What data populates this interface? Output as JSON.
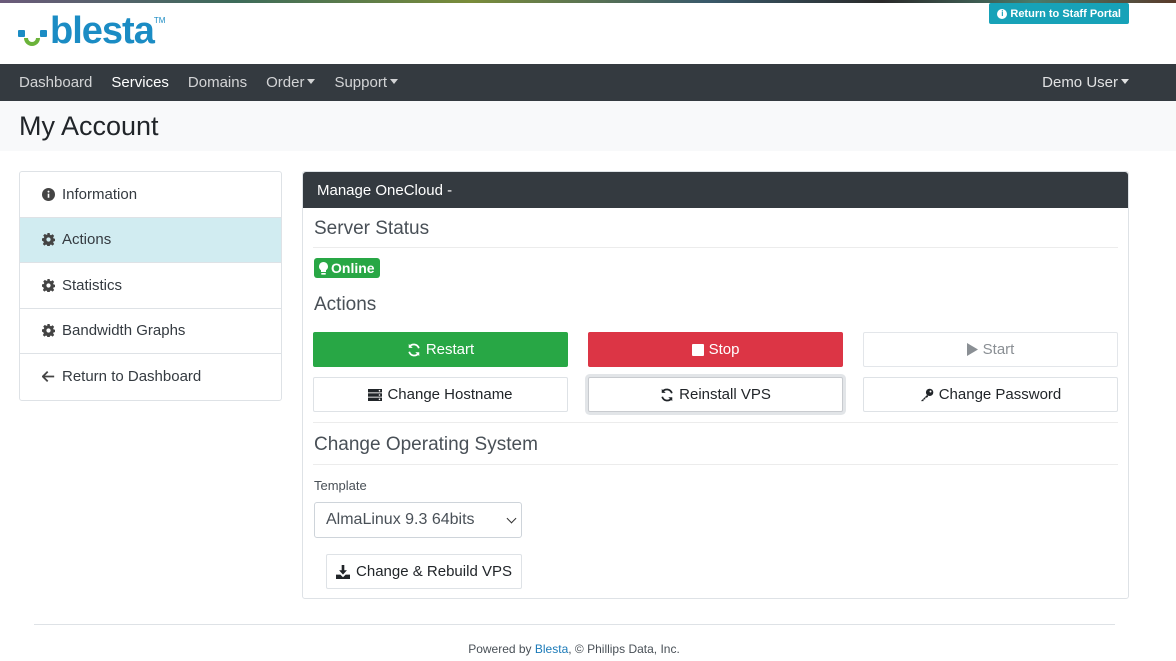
{
  "header": {
    "logo_text": "blesta",
    "logo_tm": "TM",
    "staff_portal_label": "Return to Staff Portal"
  },
  "nav": {
    "items": [
      {
        "label": "Dashboard"
      },
      {
        "label": "Services"
      },
      {
        "label": "Domains"
      },
      {
        "label": "Order"
      },
      {
        "label": "Support"
      }
    ],
    "user_label": "Demo User"
  },
  "page_title": "My Account",
  "sidebar": {
    "items": [
      {
        "label": "Information",
        "icon": "info-circle-icon"
      },
      {
        "label": "Actions",
        "icon": "gear-icon"
      },
      {
        "label": "Statistics",
        "icon": "gear-icon"
      },
      {
        "label": "Bandwidth Graphs",
        "icon": "gear-icon"
      },
      {
        "label": "Return to Dashboard",
        "icon": "arrow-left-icon"
      }
    ]
  },
  "panel": {
    "title": "Manage OneCloud -",
    "server_status_heading": "Server Status",
    "status_badge": "Online",
    "actions_heading": "Actions",
    "buttons": {
      "restart": "Restart",
      "stop": "Stop",
      "start": "Start",
      "change_hostname": "Change Hostname",
      "reinstall": "Reinstall VPS",
      "change_password": "Change Password"
    },
    "os_heading": "Change Operating System",
    "template_label": "Template",
    "template_selected": "AlmaLinux 9.3 64bits",
    "rebuild_label": "Change & Rebuild VPS"
  },
  "footer": {
    "prefix": "Powered by ",
    "link": "Blesta",
    "suffix": ", © Phillips Data, Inc."
  },
  "colors": {
    "brand_blue": "#1b8cc4",
    "brand_green": "#6bb33a",
    "navbar": "#343a40",
    "success": "#28a745",
    "danger": "#dc3545",
    "info": "#17a2b8"
  }
}
